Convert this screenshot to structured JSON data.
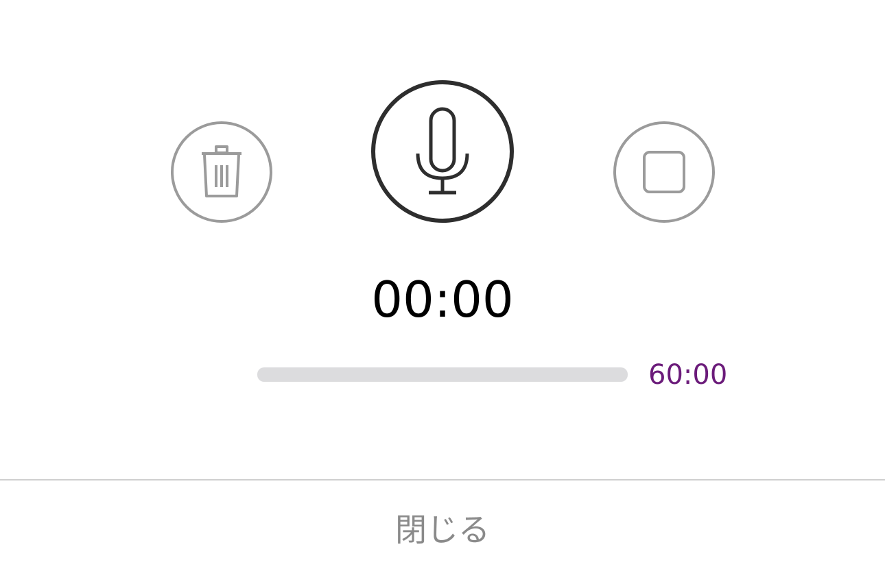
{
  "recorder": {
    "timer": "00:00",
    "max_duration": "60:00",
    "progress_fraction": 0
  },
  "controls": {
    "delete_icon": "trash-icon",
    "record_icon": "microphone-icon",
    "stop_icon": "stop-square-icon"
  },
  "footer": {
    "close_label": "閉じる"
  },
  "colors": {
    "accent": "#6b1b7a",
    "record_ring": "#2e2e2e",
    "secondary_ring": "#9b9b9b",
    "track": "#dcdcde"
  }
}
